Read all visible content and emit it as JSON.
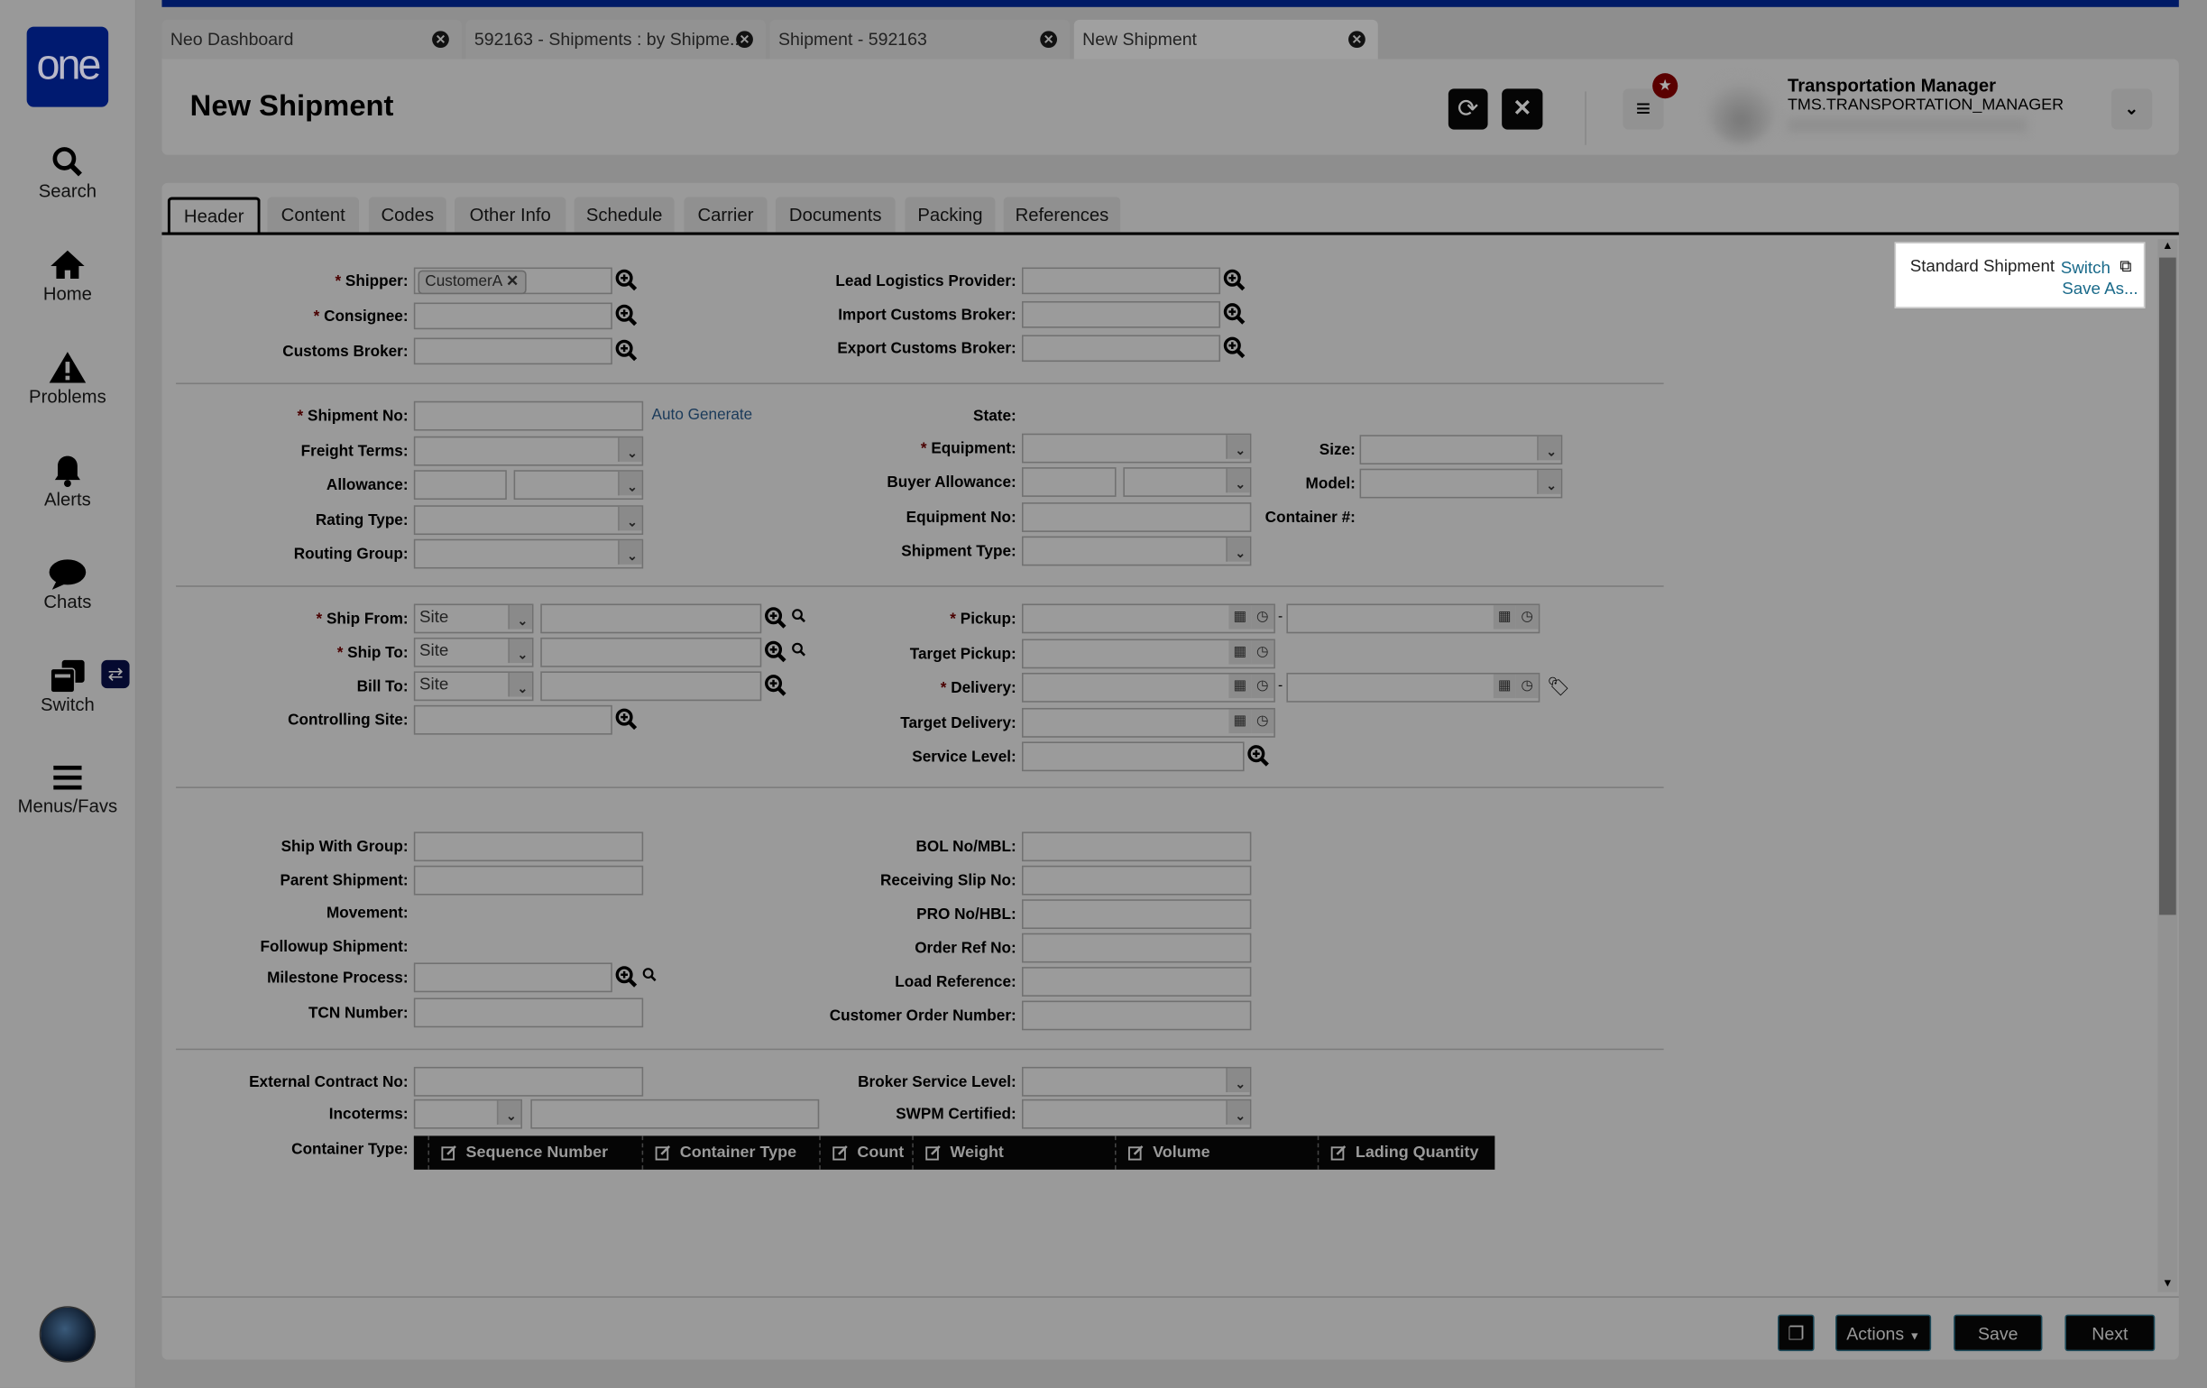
{
  "app": {
    "logo_text": "one"
  },
  "sidebar": {
    "items": [
      {
        "label": "Search",
        "icon": "search-icon"
      },
      {
        "label": "Home",
        "icon": "home-icon"
      },
      {
        "label": "Problems",
        "icon": "warning-icon"
      },
      {
        "label": "Alerts",
        "icon": "bell-icon"
      },
      {
        "label": "Chats",
        "icon": "chat-icon"
      },
      {
        "label": "Switch",
        "icon": "switch-icon"
      },
      {
        "label": "Menus/Favs",
        "icon": "menu-icon"
      }
    ]
  },
  "window_tabs": [
    {
      "label": "Neo Dashboard"
    },
    {
      "label": "592163 - Shipments : by Shipme..."
    },
    {
      "label": "Shipment - 592163"
    },
    {
      "label": "New Shipment",
      "active": true
    }
  ],
  "header": {
    "title": "New Shipment",
    "user_name": "Transportation Manager",
    "user_role": "TMS.TRANSPORTATION_MANAGER"
  },
  "form_tabs": [
    "Header",
    "Content",
    "Codes",
    "Other Info",
    "Schedule",
    "Carrier",
    "Documents",
    "Packing",
    "References"
  ],
  "layout_box": {
    "name": "Standard Shipment",
    "switch": "Switch",
    "save_as": "Save As..."
  },
  "fields": {
    "shipper": {
      "label": "Shipper:",
      "value": "CustomerA"
    },
    "consignee": "Consignee:",
    "customs_broker": "Customs Broker:",
    "lead_logistics_provider": "Lead Logistics Provider:",
    "import_customs_broker": "Import Customs Broker:",
    "export_customs_broker": "Export Customs Broker:",
    "shipment_no": "Shipment No:",
    "auto_generate": "Auto Generate",
    "freight_terms": "Freight Terms:",
    "allowance": "Allowance:",
    "rating_type": "Rating Type:",
    "routing_group": "Routing Group:",
    "state": "State:",
    "equipment": "Equipment:",
    "buyer_allowance": "Buyer Allowance:",
    "equipment_no": "Equipment No:",
    "shipment_type": "Shipment Type:",
    "size": "Size:",
    "model": "Model:",
    "container_no": "Container #:",
    "ship_from": {
      "label": "Ship From:",
      "value": "Site"
    },
    "ship_to": {
      "label": "Ship To:",
      "value": "Site"
    },
    "bill_to": {
      "label": "Bill To:",
      "value": "Site"
    },
    "controlling_site": "Controlling Site:",
    "pickup": "Pickup:",
    "target_pickup": "Target Pickup:",
    "delivery": "Delivery:",
    "target_delivery": "Target Delivery:",
    "service_level": "Service Level:",
    "ship_with_group": "Ship With Group:",
    "parent_shipment": "Parent Shipment:",
    "movement": "Movement:",
    "followup_shipment": "Followup Shipment:",
    "milestone_process": "Milestone Process:",
    "tcn_number": "TCN Number:",
    "bol_no": "BOL No/MBL:",
    "receiving_slip_no": "Receiving Slip No:",
    "pro_no": "PRO No/HBL:",
    "order_ref_no": "Order Ref No:",
    "load_reference": "Load Reference:",
    "customer_order_number": "Customer Order Number:",
    "external_contract_no": "External Contract No:",
    "incoterms": "Incoterms:",
    "broker_service_level": "Broker Service Level:",
    "swpm_certified": "SWPM Certified:",
    "container_type": "Container Type:"
  },
  "required_marker": "*",
  "container_grid": {
    "columns": [
      "Sequence Number",
      "Container Type",
      "Count",
      "Weight",
      "Volume",
      "Lading Quantity"
    ]
  },
  "footer": {
    "actions": "Actions",
    "save": "Save",
    "next": "Next"
  },
  "colors": {
    "brand": "#001a66",
    "overlay_dimmed": true
  }
}
